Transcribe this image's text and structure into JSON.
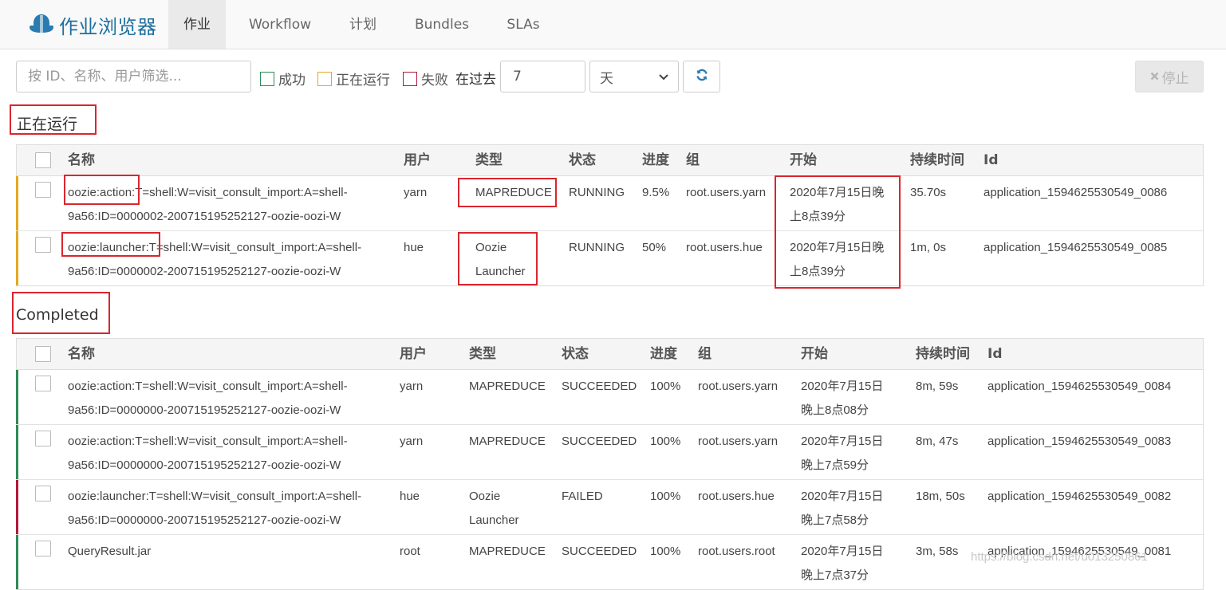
{
  "header": {
    "title": "作业浏览器",
    "tabs": [
      {
        "label": "作业",
        "active": true
      },
      {
        "label": "Workflow",
        "active": false
      },
      {
        "label": "计划",
        "active": false
      },
      {
        "label": "Bundles",
        "active": false
      },
      {
        "label": "SLAs",
        "active": false
      }
    ]
  },
  "filters": {
    "search_placeholder": "按 ID、名称、用户筛选...",
    "success_label": "成功",
    "running_label": "正在运行",
    "failed_label": "失败",
    "past_label": "在过去",
    "days_value": "7",
    "unit_value": "天",
    "stop_label": "停止"
  },
  "colors": {
    "success": "#2e8b57",
    "running": "#e5a823",
    "failed": "#b0193b",
    "brand": "#1f6f9f",
    "annotation": "#d9262e"
  },
  "icons": {
    "brand": "cloud-logo-icon",
    "refresh": "refresh-icon",
    "stop": "times-icon",
    "select": "chevron-down-icon"
  },
  "columns": [
    "名称",
    "用户",
    "类型",
    "状态",
    "进度",
    "组",
    "开始",
    "持续时间",
    "Id"
  ],
  "running": {
    "title": "正在运行",
    "rows": [
      {
        "name_line1": "oozie:action:T=shell:W=visit_consult_import:A=shell-",
        "name_line2": "9a56:ID=0000002-200715195252127-oozie-oozi-W",
        "user": "yarn",
        "type_line1": "MAPREDUCE",
        "type_line2": "",
        "status": "RUNNING",
        "progress": "9.5%",
        "group": "root.users.yarn",
        "start_line1": "2020年7月15日晚",
        "start_line2": "上8点39分",
        "duration": "35.70s",
        "id": "application_1594625530549_0086",
        "state": "running"
      },
      {
        "name_line1": "oozie:launcher:T=shell:W=visit_consult_import:A=shell-",
        "name_line2": "9a56:ID=0000002-200715195252127-oozie-oozi-W",
        "user": "hue",
        "type_line1": "Oozie",
        "type_line2": "Launcher",
        "status": "RUNNING",
        "progress": "50%",
        "group": "root.users.hue",
        "start_line1": "2020年7月15日晚",
        "start_line2": "上8点39分",
        "duration": "1m, 0s",
        "id": "application_1594625530549_0085",
        "state": "running"
      }
    ]
  },
  "completed": {
    "title": "Completed",
    "rows": [
      {
        "name_line1": "oozie:action:T=shell:W=visit_consult_import:A=shell-",
        "name_line2": "9a56:ID=0000000-200715195252127-oozie-oozi-W",
        "user": "yarn",
        "type_line1": "MAPREDUCE",
        "type_line2": "",
        "status": "SUCCEEDED",
        "progress": "100%",
        "group": "root.users.yarn",
        "start_line1": "2020年7月15日",
        "start_line2": "晚上8点08分",
        "duration": "8m, 59s",
        "id": "application_1594625530549_0084",
        "state": "success"
      },
      {
        "name_line1": "oozie:action:T=shell:W=visit_consult_import:A=shell-",
        "name_line2": "9a56:ID=0000000-200715195252127-oozie-oozi-W",
        "user": "yarn",
        "type_line1": "MAPREDUCE",
        "type_line2": "",
        "status": "SUCCEEDED",
        "progress": "100%",
        "group": "root.users.yarn",
        "start_line1": "2020年7月15日",
        "start_line2": "晚上7点59分",
        "duration": "8m, 47s",
        "id": "application_1594625530549_0083",
        "state": "success"
      },
      {
        "name_line1": "oozie:launcher:T=shell:W=visit_consult_import:A=shell-",
        "name_line2": "9a56:ID=0000000-200715195252127-oozie-oozi-W",
        "user": "hue",
        "type_line1": "Oozie",
        "type_line2": "Launcher",
        "status": "FAILED",
        "progress": "100%",
        "group": "root.users.hue",
        "start_line1": "2020年7月15日",
        "start_line2": "晚上7点58分",
        "duration": "18m, 50s",
        "id": "application_1594625530549_0082",
        "state": "failed"
      },
      {
        "name_line1": "QueryResult.jar",
        "name_line2": "",
        "user": "root",
        "type_line1": "MAPREDUCE",
        "type_line2": "",
        "status": "SUCCEEDED",
        "progress": "100%",
        "group": "root.users.root",
        "start_line1": "2020年7月15日",
        "start_line2": "晚上7点37分",
        "duration": "3m, 58s",
        "id": "application_1594625530549_0081",
        "state": "success"
      }
    ]
  },
  "watermark": "https://blog.csdn.net/u013250861"
}
